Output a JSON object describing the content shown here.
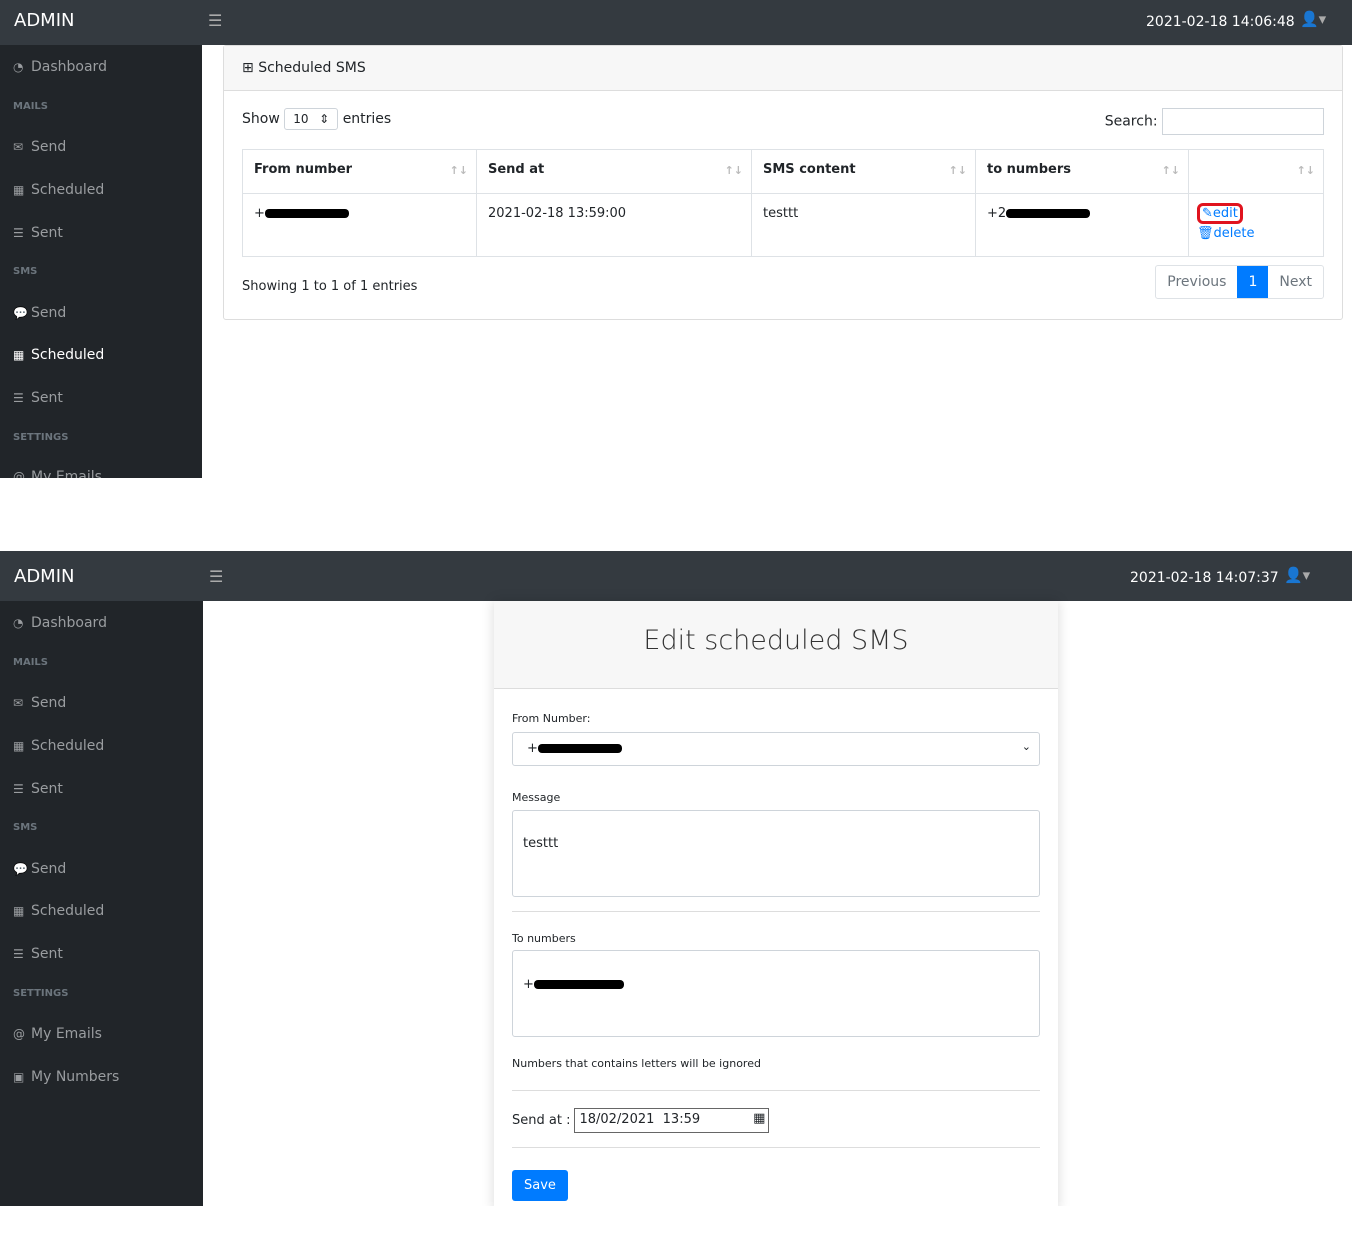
{
  "top": {
    "brand": "ADMIN",
    "datetime": "2021-02-18 14:06:48",
    "card_title": "Scheduled SMS",
    "show": "Show",
    "page_size": "10",
    "entries": "entries",
    "search_label": "Search:",
    "search_value": "",
    "columns": [
      "From number",
      "Send at",
      "SMS content",
      "to numbers",
      ""
    ],
    "row": {
      "from_prefix": "+",
      "send_at": "2021-02-18 13:59:00",
      "content": "testtt",
      "to_prefix": "+2",
      "edit": "edit",
      "delete": "delete"
    },
    "info": "Showing 1 to 1 of 1 entries",
    "prev": "Previous",
    "page": "1",
    "next": "Next"
  },
  "sidebar": {
    "dashboard": "Dashboard",
    "mails": "MAILS",
    "send": "Send",
    "scheduled": "Scheduled",
    "sent": "Sent",
    "sms": "SMS",
    "settings": "SETTINGS",
    "my_emails": "My Emails",
    "my_numbers": "My Numbers"
  },
  "bottom": {
    "brand": "ADMIN",
    "datetime": "2021-02-18 14:07:37",
    "title": "Edit scheduled SMS",
    "from_label": "From Number:",
    "from_prefix": "+",
    "message_label": "Message",
    "message": "testtt",
    "to_label": "To numbers",
    "to_prefix": "+",
    "hint": "Numbers that contains letters will be ignored",
    "send_at_label": "Send at :",
    "send_at": "18/02/2021  13:59",
    "save": "Save"
  }
}
